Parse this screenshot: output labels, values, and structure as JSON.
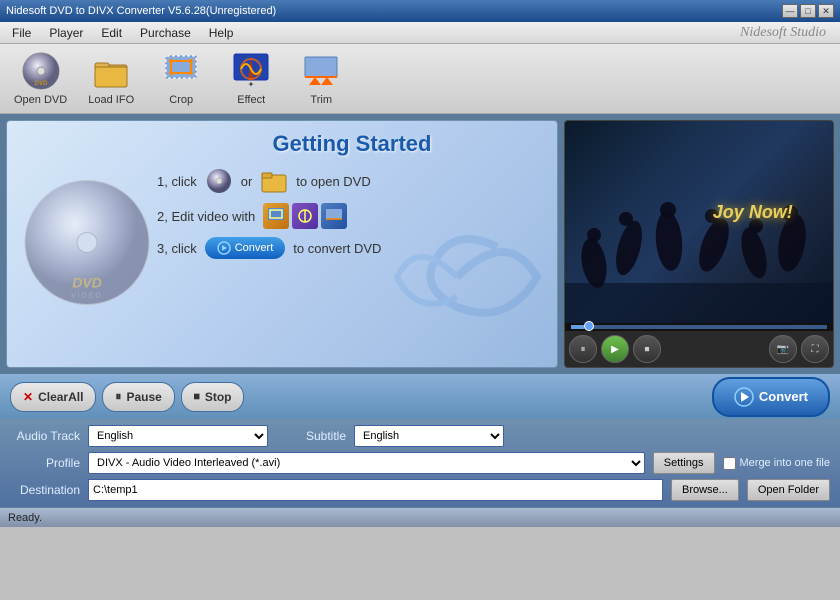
{
  "app": {
    "title": "Nidesoft DVD to DIVX Converter V5.6.28(Unregistered)",
    "brand": "Nidesoft Studio"
  },
  "title_buttons": {
    "minimize": "—",
    "maximize": "□",
    "close": "✕"
  },
  "menu": {
    "items": [
      "File",
      "Player",
      "Edit",
      "Purchase",
      "Help"
    ]
  },
  "toolbar": {
    "buttons": [
      {
        "label": "Open DVD",
        "icon": "dvd-icon"
      },
      {
        "label": "Load IFO",
        "icon": "folder-icon"
      },
      {
        "label": "Crop",
        "icon": "crop-icon"
      },
      {
        "label": "Effect",
        "icon": "effect-icon"
      },
      {
        "label": "Trim",
        "icon": "trim-icon"
      }
    ]
  },
  "getting_started": {
    "title": "Getting  Started",
    "step1": "1, click",
    "step1_end": "to open DVD",
    "step1_or": "or",
    "step2": "2, Edit video with",
    "step3": "3, click",
    "step3_end": "to convert DVD",
    "convert_label": "Convert"
  },
  "preview": {
    "joy_text": "Joy Now!"
  },
  "action_bar": {
    "clearall": "ClearAll",
    "pause": "Pause",
    "stop": "Stop",
    "convert": "Convert"
  },
  "settings": {
    "audio_track_label": "Audio Track",
    "audio_track_value": "English",
    "subtitle_label": "Subtitle",
    "subtitle_value": "English",
    "profile_label": "Profile",
    "profile_value": "DIVX - Audio Video Interleaved (*.avi)",
    "settings_btn": "Settings",
    "merge_label": "Merge into one file",
    "destination_label": "Destination",
    "destination_value": "C:\\temp1",
    "browse_btn": "Browse...",
    "open_folder_btn": "Open Folder"
  },
  "status": {
    "text": "Ready."
  }
}
